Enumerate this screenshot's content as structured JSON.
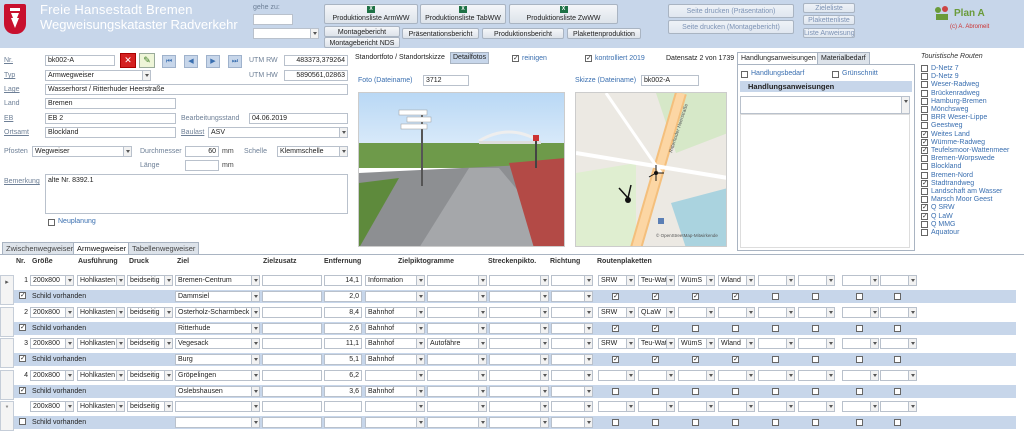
{
  "header": {
    "title_line1": "Freie Hansestadt Bremen",
    "title_line2": "Wegweisungskataster Radverkehr",
    "gehe_zu_label": "gehe zu:",
    "buttons": {
      "produktion_arm": "Produktionsliste ArmWW",
      "produktion_tab": "Produktionsliste TabWW",
      "produktion_zw": "Produktionsliste ZwWW",
      "montagebericht": "Montagebericht",
      "montagebericht_nds": "Montagebericht NDS",
      "praesentationsbericht": "Präsentationsbericht",
      "produktionsbericht": "Produktionsbericht",
      "plakettenproduktion": "Plakettenproduktion",
      "seite_druck_praes": "Seite drucken (Präsentation)",
      "seite_druck_mont": "Seite drucken (Montagebericht)",
      "zieleliste": "Zieleliste",
      "plakettenliste": "Plakettenliste",
      "liste_anweisungen": "Liste Anweisungen"
    },
    "brand": "Plan A",
    "copyright": "(c) A. Abromeit"
  },
  "form": {
    "nr_label": "Nr.",
    "nr_value": "bk002-A",
    "typ_label": "Typ",
    "typ_value": "Armwegweiser",
    "lage_label": "Lage",
    "lage_value": "Wasserhorst / Ritterhuder Heerstraße",
    "land_label": "Land",
    "land_value": "Bremen",
    "eb_label": "EB",
    "eb_value": "EB 2",
    "ortsamt_label": "Ortsamt",
    "ortsamt_value": "Blockland",
    "pfosten_label": "Pfosten",
    "pfosten_value": "Wegweiser",
    "bemerkung_label": "Bemerkung",
    "bemerkung_value": "alte Nr. 8392.1",
    "neuplanung_label": "Neuplanung",
    "utm_rw_label": "UTM RW",
    "utm_rw_value": "483373,379264",
    "utm_hw_label": "UTM HW",
    "utm_hw_value": "5890561,02863",
    "bearbeitungsstand_label": "Bearbeitungsstand",
    "bearbeitungsstand_value": "04.06.2019",
    "baulast_label": "Baulast",
    "baulast_value": "ASV",
    "durchmesser_label": "Durchmesser",
    "durchmesser_value": "60",
    "durchmesser_unit": "mm",
    "laenge_label": "Länge",
    "laenge_unit": "mm",
    "schelle_label": "Schelle",
    "schelle_value": "Klemmschelle",
    "nav": [
      "⏮",
      "◀",
      "▶",
      "⏭"
    ]
  },
  "media": {
    "tab_standort": "Standortfoto / Standortskizze",
    "tab_detail": "Detailfotos",
    "reinigen_label": "reinigen",
    "kontrolliert_label": "kontrolliert 2019",
    "datensatz": "Datensatz 2 von 1739",
    "foto_label": "Foto (Dateiname)",
    "foto_value": "3712",
    "skizze_label": "Skizze (Dateiname)",
    "skizze_value": "bk002-A",
    "map_credit": "© OpenStreetMap-Mitwirkende"
  },
  "handlung": {
    "tab1": "Handlungsanweisungen",
    "tab2": "Materialbedarf",
    "handlungsbedarf": "Handlungsbedarf",
    "gruenschnitt": "Grünschnitt",
    "heading": "Handlungsanweisungen"
  },
  "touristische": {
    "title": "Touristische Routen",
    "items": [
      {
        "label": "D-Netz 7",
        "checked": false
      },
      {
        "label": "D-Netz 9",
        "checked": false
      },
      {
        "label": "Weser-Radweg",
        "checked": false
      },
      {
        "label": "Brückenradweg",
        "checked": false
      },
      {
        "label": "Hamburg-Bremen",
        "checked": false
      },
      {
        "label": "Mönchsweg",
        "checked": false
      },
      {
        "label": "BRR Weser-Lippe",
        "checked": false
      },
      {
        "label": "Geestweg",
        "checked": false
      },
      {
        "label": "Weites Land",
        "checked": true
      },
      {
        "label": "Wümme-Radweg",
        "checked": true
      },
      {
        "label": "Teufelsmoor-Wattenmeer",
        "checked": true
      },
      {
        "label": "Bremen-Worpswede",
        "checked": false
      },
      {
        "label": "Blockland",
        "checked": false
      },
      {
        "label": "Bremen-Nord",
        "checked": false
      },
      {
        "label": "Stadtrandweg",
        "checked": true
      },
      {
        "label": "Landschaft am Wasser",
        "checked": false
      },
      {
        "label": "Marsch Moor Geest",
        "checked": false
      },
      {
        "label": "Q SRW",
        "checked": true
      },
      {
        "label": "Q LaW",
        "checked": true
      },
      {
        "label": "Q MMG",
        "checked": false
      },
      {
        "label": "Aquatour",
        "checked": false
      }
    ]
  },
  "tabs": [
    "Zwischenwegweiser",
    "Armwegweiser",
    "Tabellenwegweiser"
  ],
  "grid": {
    "headers": [
      "Nr.",
      "Größe",
      "Ausführung",
      "Druck",
      "Ziel",
      "Zielzusatz",
      "Entfernung",
      "Zielpiktogramme",
      "Streckenpikto.",
      "Richtung",
      "Routenplaketten"
    ],
    "schild_label": "Schild vorhanden",
    "rows": [
      {
        "nr": "1",
        "groesse": "200x800",
        "ausfuehrung": "Hohlkasten",
        "druck": "beidseitig",
        "ziel1": "Bremen-Centrum",
        "ent1": "14,1",
        "pik1": "Information",
        "ziel2": "Dammsiel",
        "ent2": "2,0",
        "strecke": "",
        "p": [
          "SRW",
          "Teu-Wat",
          "WümS",
          "Wland"
        ]
      },
      {
        "nr": "2",
        "groesse": "200x800",
        "ausfuehrung": "Hohlkasten",
        "druck": "beidseitig",
        "ziel1": "Osterholz-Scharmbeck",
        "ent1": "8,4",
        "pik1": "Bahnhof",
        "ziel2": "Ritterhude",
        "ent2": "2,6",
        "pik2": "Bahnhof",
        "strecke": "",
        "p": [
          "SRW",
          "QLaW",
          "",
          ""
        ]
      },
      {
        "nr": "3",
        "groesse": "200x800",
        "ausfuehrung": "Hohlkasten",
        "druck": "beidseitig",
        "ziel1": "Vegesack",
        "ent1": "11,1",
        "pik1": "Bahnhof",
        "ziel2": "Burg",
        "ent2": "5,1",
        "pik2": "Bahnhof",
        "strecke": "Autofähre",
        "p": [
          "SRW",
          "Teu-Wat",
          "WümS",
          "Wland"
        ]
      },
      {
        "nr": "4",
        "groesse": "200x800",
        "ausfuehrung": "Hohlkasten",
        "druck": "beidseitig",
        "ziel1": "Gröpelingen",
        "ent1": "6,2",
        "pik1": "",
        "ziel2": "Oslebshausen",
        "ent2": "3,6",
        "pik2": "Bahnhof",
        "strecke": "",
        "p": [
          "",
          "",
          "",
          ""
        ]
      },
      {
        "nr": "",
        "groesse": "200x800",
        "ausfuehrung": "Hohlkasten",
        "druck": "beidseitig",
        "ziel1": "",
        "ent1": "",
        "pik1": "",
        "ziel2": "",
        "ent2": "",
        "pik2": "",
        "strecke": "",
        "p": [
          "",
          "",
          "",
          ""
        ]
      }
    ]
  }
}
